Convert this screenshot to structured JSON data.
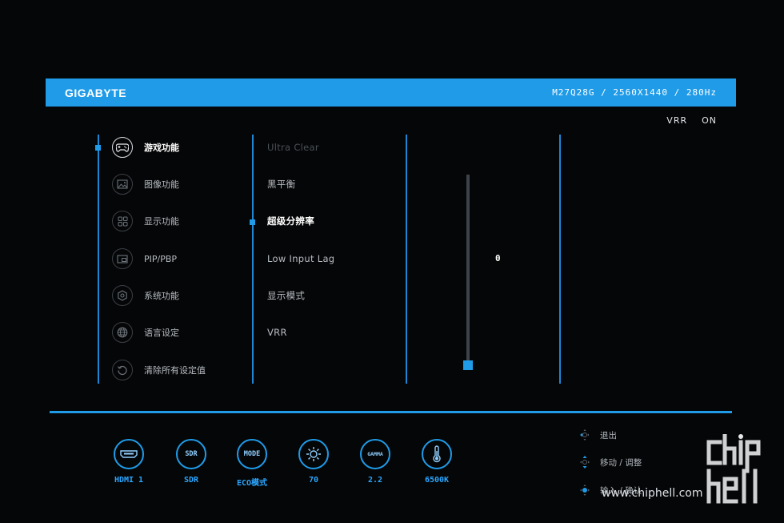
{
  "header": {
    "brand": "GIGABYTE",
    "model_info": "M27Q28G / 2560X1440 / 280Hz"
  },
  "vrr_status": {
    "label": "VRR",
    "value": "ON"
  },
  "main_menu": [
    {
      "label": "游戏功能",
      "icon": "gamepad-icon",
      "active": true
    },
    {
      "label": "图像功能",
      "icon": "picture-icon",
      "active": false
    },
    {
      "label": "显示功能",
      "icon": "grid-icon",
      "active": false
    },
    {
      "label": "PIP/PBP",
      "icon": "pip-icon",
      "active": false
    },
    {
      "label": "系统功能",
      "icon": "gear-icon",
      "active": false
    },
    {
      "label": "语言设定",
      "icon": "globe-icon",
      "active": false
    },
    {
      "label": "清除所有设定值",
      "icon": "reset-icon",
      "active": false
    }
  ],
  "sub_menu": [
    {
      "label": "Ultra Clear",
      "state": "disabled"
    },
    {
      "label": "黑平衡",
      "state": "normal"
    },
    {
      "label": "超级分辨率",
      "state": "active"
    },
    {
      "label": "Low Input Lag",
      "state": "normal"
    },
    {
      "label": "显示模式",
      "state": "normal"
    },
    {
      "label": "VRR",
      "state": "normal"
    }
  ],
  "slider": {
    "value": "0",
    "level": 0
  },
  "status_bar": [
    {
      "ring": "HDMI",
      "label": "HDMI 1",
      "icon": "hdmi-icon"
    },
    {
      "ring": "SDR",
      "label": "SDR",
      "icon": "sdr-icon"
    },
    {
      "ring": "MODE",
      "label": "ECO模式",
      "icon": "mode-icon"
    },
    {
      "ring": "☼",
      "label": "70",
      "icon": "brightness-icon"
    },
    {
      "ring": "GAMMA",
      "label": "2.2",
      "icon": "gamma-icon"
    },
    {
      "ring": "🌡",
      "label": "6500K",
      "icon": "thermometer-icon"
    }
  ],
  "nav_hints": [
    {
      "label": "退出",
      "icon": "joystick-left-icon"
    },
    {
      "label": "移动 / 调整",
      "icon": "joystick-updown-icon"
    },
    {
      "label": "输入 / 确认",
      "icon": "joystick-press-icon"
    }
  ],
  "watermark": {
    "text": "www.chiphell.com",
    "logo_text": "chip hell"
  },
  "colors": {
    "accent": "#1f9be8",
    "background": "#050607",
    "text": "#d7dbe0"
  }
}
